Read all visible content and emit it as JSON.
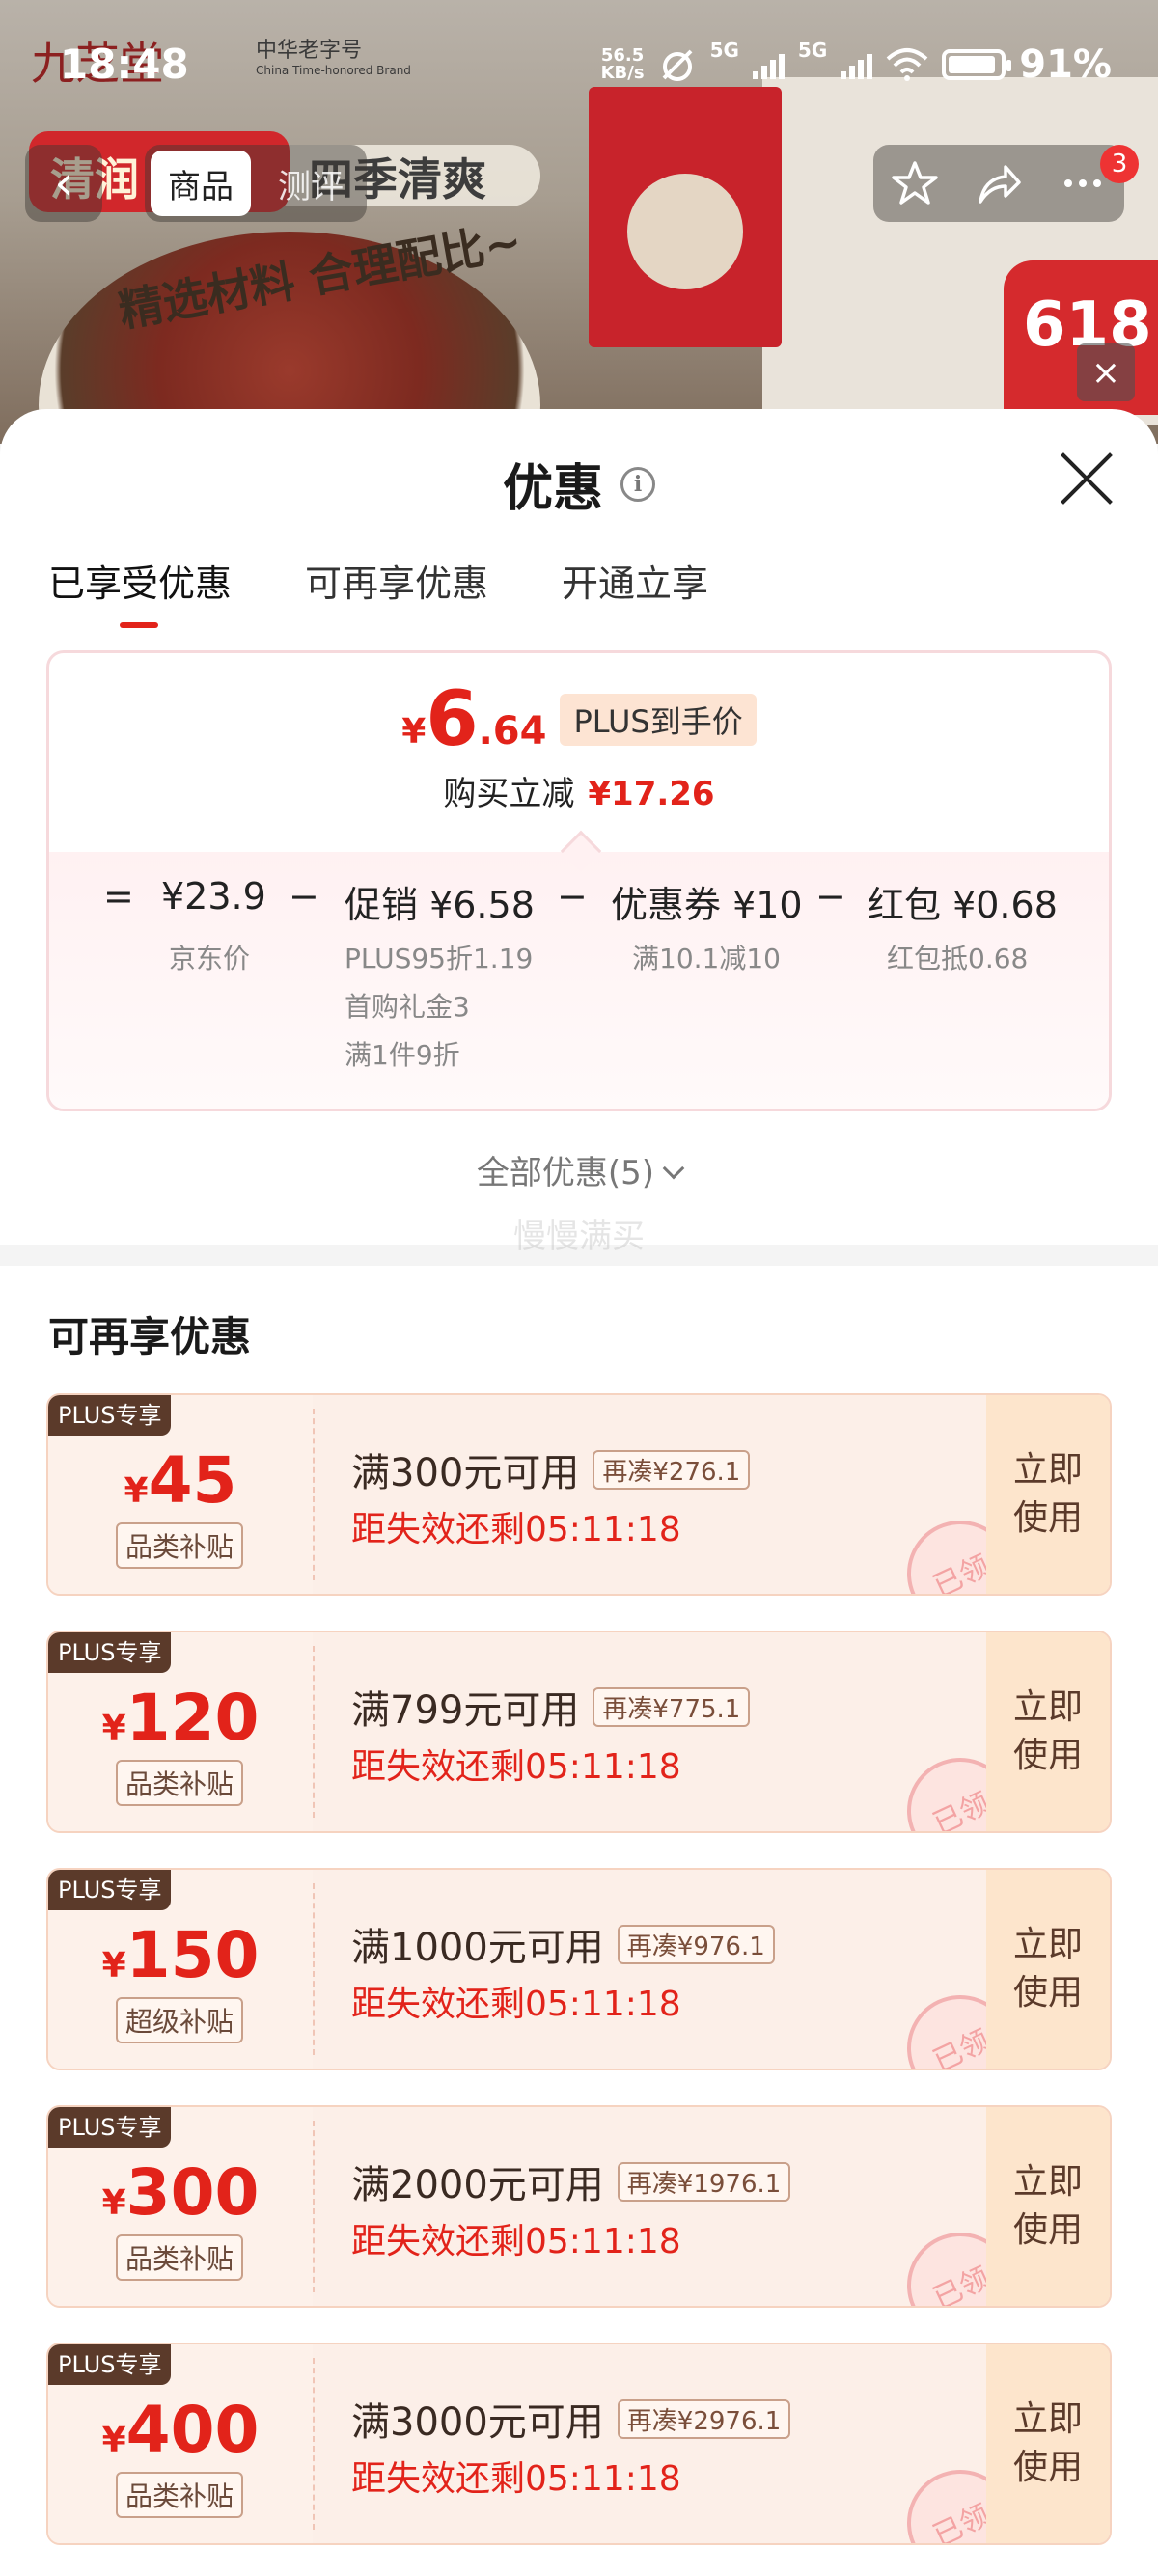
{
  "status_bar": {
    "time": "18:48",
    "net_speed_value": "56.5",
    "net_speed_unit": "KB/s",
    "signal1": "5G",
    "signal2": "5G",
    "battery": "91%"
  },
  "background": {
    "brand_name": "九芝堂",
    "brand_tag": "中华老字号",
    "brand_tag_en": "China Time-honored Brand",
    "banner_left": "清润",
    "banner_right": "四季清爽",
    "slogan": "精选材料 合理配比~",
    "promo": "618"
  },
  "nav": {
    "back_icon": "chevron-left-icon",
    "tabs": [
      {
        "label": "商品"
      },
      {
        "label": "测评"
      }
    ],
    "badge": "3"
  },
  "sheet": {
    "title": "优惠",
    "tabs": [
      {
        "label": "已享受优惠"
      },
      {
        "label": "可再享优惠"
      },
      {
        "label": "开通立享"
      }
    ],
    "summary": {
      "price_yen": "¥",
      "price_int": "6",
      "price_dec": ".64",
      "price_tag": "PLUS到手价",
      "reduce_label": "购买立减",
      "reduce_value": "¥17.26",
      "formula": [
        {
          "op": "=",
          "label": "¥23.9",
          "subs": [
            "京东价"
          ]
        },
        {
          "op": "−",
          "label": "促销 ¥6.58",
          "subs": [
            "PLUS95折1.19",
            "首购礼金3",
            "满1件9折"
          ]
        },
        {
          "op": "−",
          "label": "优惠券 ¥10",
          "subs": [
            "满10.1减10"
          ]
        },
        {
          "op": "−",
          "label": "红包 ¥0.68",
          "subs": [
            "红包抵0.68"
          ]
        }
      ]
    },
    "all_offers": "全部优惠(5)",
    "watermark": "慢慢满买",
    "section_title": "可再享优惠",
    "coupons": [
      {
        "tag": "PLUS专享",
        "yen": "¥",
        "amount": "45",
        "type": "品类补贴",
        "condition": "满300元可用",
        "need": "再凑¥276.1",
        "timer": "距失效还剩05:11:18",
        "button": "立即使用",
        "stamp": "已领"
      },
      {
        "tag": "PLUS专享",
        "yen": "¥",
        "amount": "120",
        "type": "品类补贴",
        "condition": "满799元可用",
        "need": "再凑¥775.1",
        "timer": "距失效还剩05:11:18",
        "button": "立即使用",
        "stamp": "已领"
      },
      {
        "tag": "PLUS专享",
        "yen": "¥",
        "amount": "150",
        "type": "超级补贴",
        "condition": "满1000元可用",
        "need": "再凑¥976.1",
        "timer": "距失效还剩05:11:18",
        "button": "立即使用",
        "stamp": "已领"
      },
      {
        "tag": "PLUS专享",
        "yen": "¥",
        "amount": "300",
        "type": "品类补贴",
        "condition": "满2000元可用",
        "need": "再凑¥1976.1",
        "timer": "距失效还剩05:11:18",
        "button": "立即使用",
        "stamp": "已领"
      },
      {
        "tag": "PLUS专享",
        "yen": "¥",
        "amount": "400",
        "type": "品类补贴",
        "condition": "满3000元可用",
        "need": "再凑¥2976.1",
        "timer": "距失效还剩05:11:18",
        "button": "立即使用",
        "stamp": "已领"
      }
    ]
  },
  "colors": {
    "accent": "#e2231a",
    "tag_bg": "#5b3a2a",
    "coupon_bg": "#fcefe8",
    "button_bg": "#fde5cc"
  }
}
